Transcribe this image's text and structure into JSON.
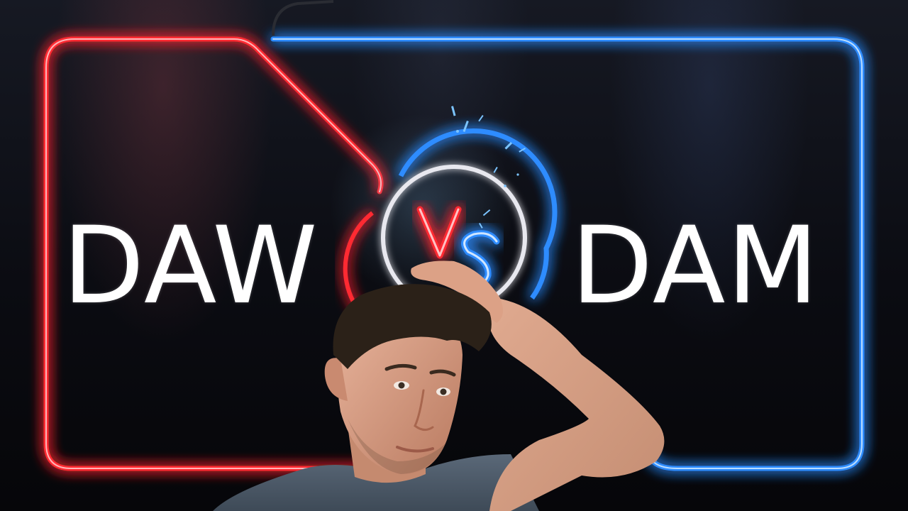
{
  "thumbnail": {
    "left_word": "DAW",
    "right_word": "DAM",
    "center_badge_text": "VS",
    "colors": {
      "left_neon": "#ff2a33",
      "right_neon": "#2e8cff",
      "badge_ring": "#e8e8ef",
      "text": "#ffffff",
      "background": "#0b0c12"
    }
  }
}
